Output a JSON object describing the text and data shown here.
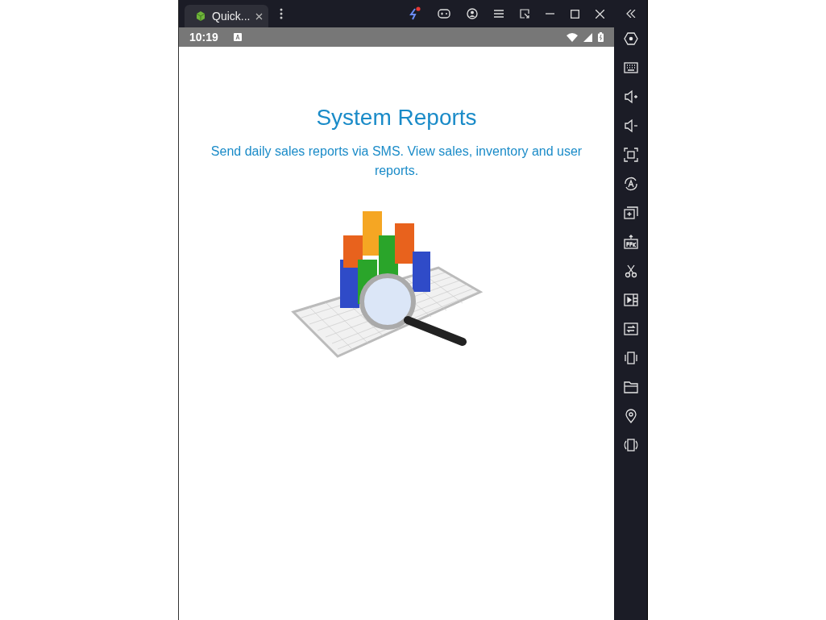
{
  "tab": {
    "title": "Quick...",
    "selected": true
  },
  "status_bar": {
    "time": "10:19"
  },
  "content": {
    "title": "System Reports",
    "description": "Send daily sales reports via SMS. View sales, inventory and user reports."
  }
}
